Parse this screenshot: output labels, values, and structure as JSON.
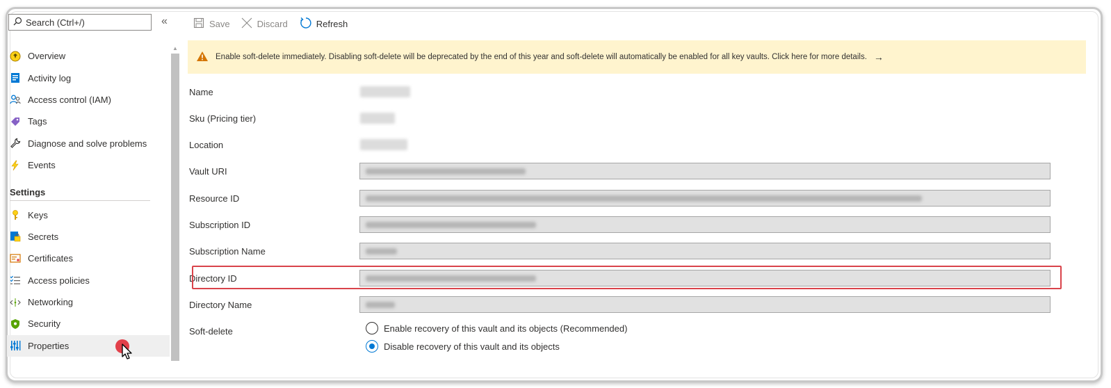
{
  "sidebar": {
    "search_placeholder": "Search (Ctrl+/)",
    "collapse_glyph": "«",
    "items_top": [
      {
        "label": "Overview",
        "icon": "overview-icon"
      },
      {
        "label": "Activity log",
        "icon": "activity-log-icon"
      },
      {
        "label": "Access control (IAM)",
        "icon": "access-control-icon"
      },
      {
        "label": "Tags",
        "icon": "tag-icon"
      },
      {
        "label": "Diagnose and solve problems",
        "icon": "wrench-icon"
      },
      {
        "label": "Events",
        "icon": "lightning-icon"
      }
    ],
    "section_title": "Settings",
    "items_settings": [
      {
        "label": "Keys",
        "icon": "key-icon"
      },
      {
        "label": "Secrets",
        "icon": "secret-icon"
      },
      {
        "label": "Certificates",
        "icon": "certificate-icon"
      },
      {
        "label": "Access policies",
        "icon": "access-policies-icon"
      },
      {
        "label": "Networking",
        "icon": "networking-icon"
      },
      {
        "label": "Security",
        "icon": "shield-icon"
      },
      {
        "label": "Properties",
        "icon": "properties-icon",
        "active": true
      }
    ]
  },
  "toolbar": {
    "save_label": "Save",
    "discard_label": "Discard",
    "refresh_label": "Refresh"
  },
  "banner": {
    "text": "Enable soft-delete immediately. Disabling soft-delete will be deprecated by the end of this year and soft-delete will automatically be enabled for all key vaults. Click here for more details.",
    "arrow": "→"
  },
  "properties": {
    "name_label": "Name",
    "sku_label": "Sku (Pricing tier)",
    "location_label": "Location",
    "vault_uri_label": "Vault URI",
    "resource_id_label": "Resource ID",
    "subscription_id_label": "Subscription ID",
    "subscription_name_label": "Subscription Name",
    "directory_id_label": "Directory ID",
    "directory_name_label": "Directory Name",
    "soft_delete_label": "Soft-delete",
    "soft_delete_options": [
      {
        "label": "Enable recovery of this vault and its objects (Recommended)",
        "checked": false
      },
      {
        "label": "Disable recovery of this vault and its objects",
        "checked": true
      }
    ]
  },
  "colors": {
    "accent": "#0078d4",
    "warning": "#d47500",
    "banner_bg": "#fff4ce",
    "highlight": "#d9434a"
  }
}
